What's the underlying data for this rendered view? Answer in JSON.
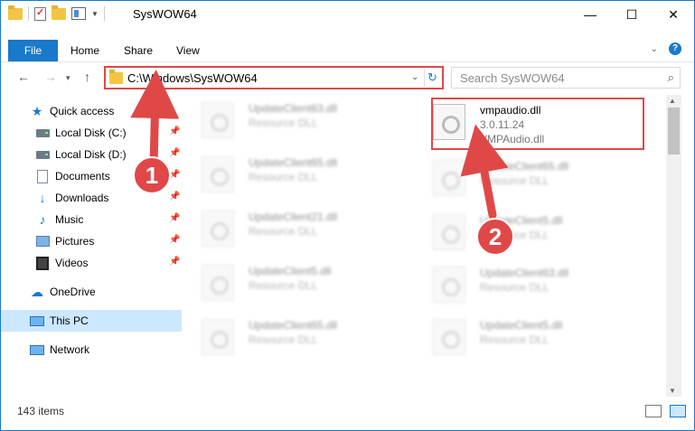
{
  "window": {
    "title": "SysWOW64",
    "controls": {
      "minimize": "—",
      "maximize": "☐",
      "close": "✕"
    }
  },
  "ribbon": {
    "tabs": [
      {
        "label": "File",
        "active": true
      },
      {
        "label": "Home"
      },
      {
        "label": "Share"
      },
      {
        "label": "View"
      }
    ],
    "collapse_glyph": "⌄",
    "help_glyph": "?"
  },
  "navigation": {
    "back_glyph": "←",
    "forward_glyph": "→",
    "recent_glyph": "▾",
    "up_glyph": "↑",
    "address": "C:\\Windows\\SysWOW64",
    "address_caret": "⌄",
    "refresh_glyph": "↻",
    "search_placeholder": "Search SysWOW64",
    "search_glyph": "⌕"
  },
  "sidebar": {
    "items": [
      {
        "label": "Quick access",
        "icon": "star-icon",
        "pinned": false
      },
      {
        "label": "Local Disk (C:)",
        "icon": "drive-icon",
        "pinned": true
      },
      {
        "label": "Local Disk (D:)",
        "icon": "drive-icon",
        "pinned": true
      },
      {
        "label": "Documents",
        "icon": "documents-icon",
        "pinned": true
      },
      {
        "label": "Downloads",
        "icon": "download-icon",
        "pinned": true
      },
      {
        "label": "Music",
        "icon": "music-icon",
        "pinned": true
      },
      {
        "label": "Pictures",
        "icon": "pictures-icon",
        "pinned": true
      },
      {
        "label": "Videos",
        "icon": "video-icon",
        "pinned": true
      },
      {
        "label": "OneDrive",
        "icon": "onedrive-icon"
      },
      {
        "label": "This PC",
        "icon": "this-pc-icon",
        "selected": true
      },
      {
        "label": "Network",
        "icon": "network-icon"
      }
    ]
  },
  "files": {
    "left_column": [
      {
        "name": "UpdateClient63.dll",
        "type": "Resource DLL"
      },
      {
        "name": "UpdateClient65.dll",
        "type": "Resource DLL"
      },
      {
        "name": "UpdateClient21.dll",
        "type": "Resource DLL"
      },
      {
        "name": "UpdateClient5.dll",
        "type": "Resource DLL"
      },
      {
        "name": "UpdateClient65.dll",
        "type": "Resource DLL"
      }
    ],
    "right_column": [
      {
        "name": "UpdateClient65.dll",
        "type": "Resource DLL"
      },
      {
        "name": "UpdateClient5.dll",
        "type": "Resource DLL"
      },
      {
        "name": "UpdateClient63.dll",
        "type": "Resource DLL"
      },
      {
        "name": "UpdateClient5.dll",
        "type": "Resource DLL"
      }
    ],
    "highlighted": {
      "name": "vmpaudio.dll",
      "version": "3.0.11.24",
      "description": "VMPAudio.dll"
    }
  },
  "status": {
    "items_count": "143 items"
  },
  "annotations": {
    "marker_1": "1",
    "marker_2": "2",
    "color": "#e04848"
  }
}
